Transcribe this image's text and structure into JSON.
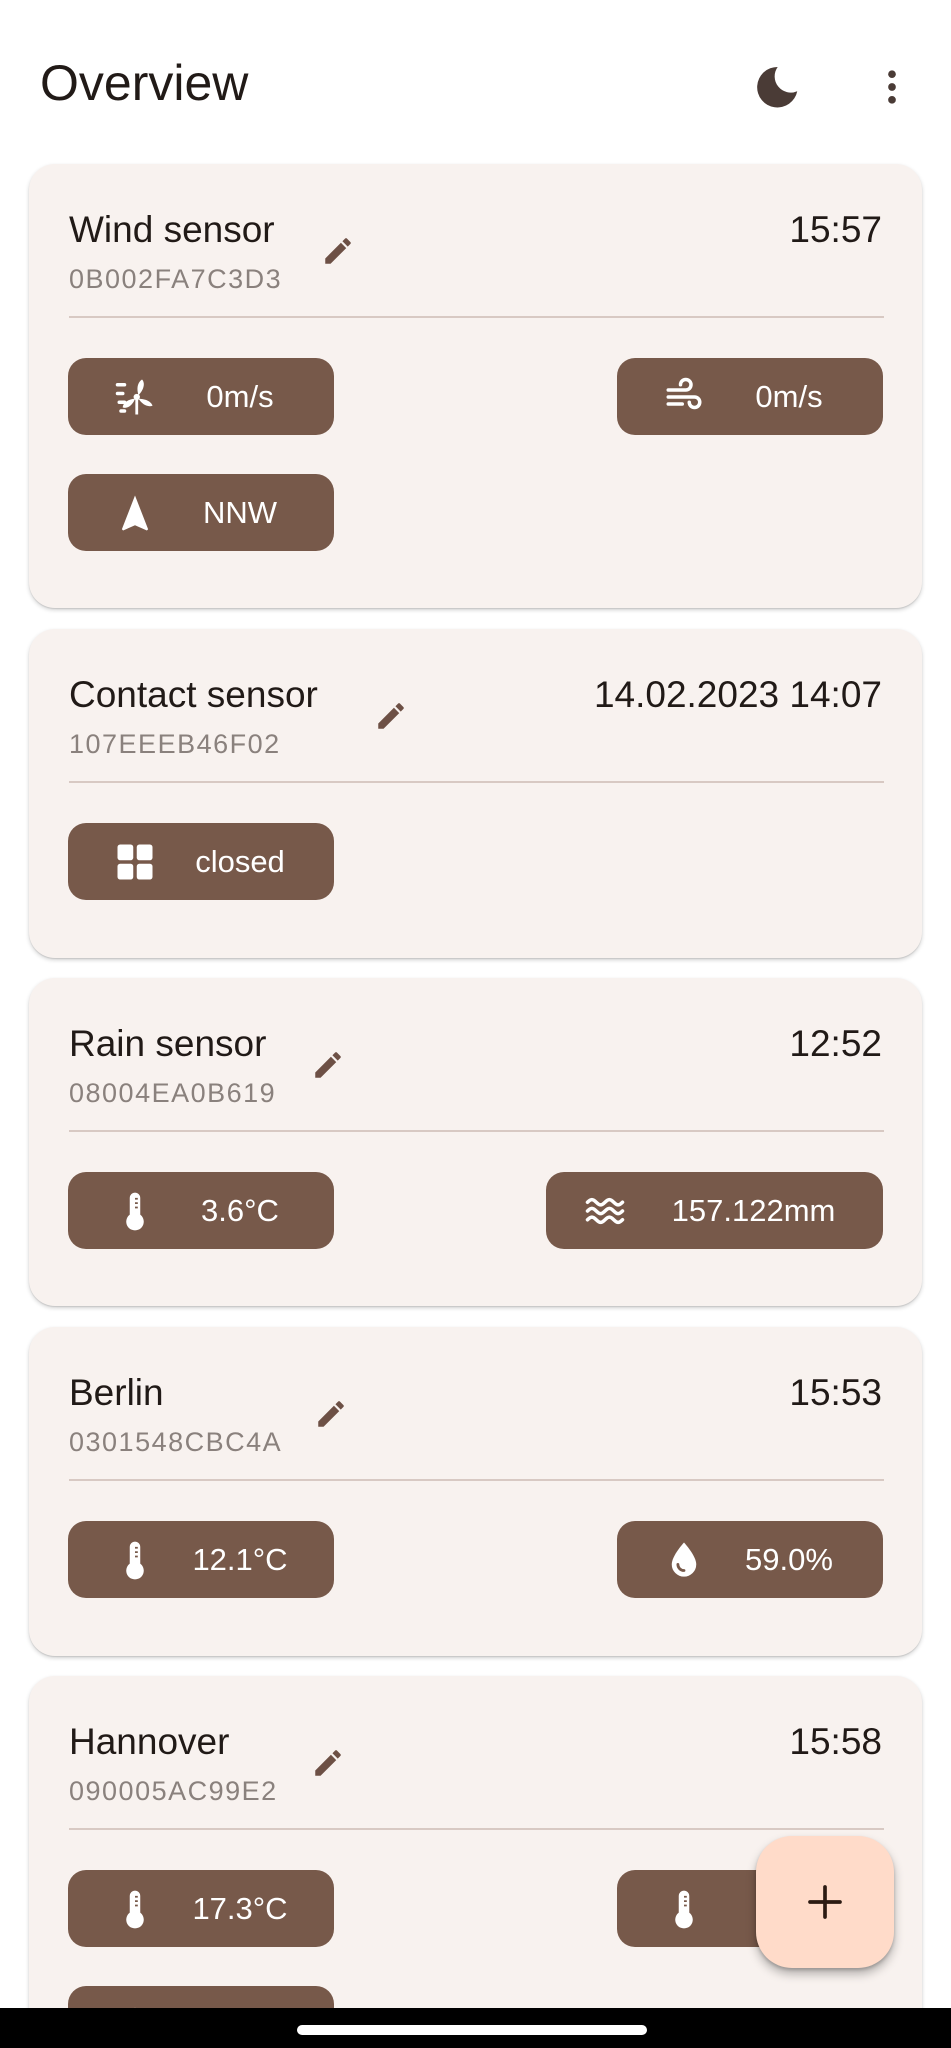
{
  "app": {
    "title": "Overview",
    "icons": {
      "theme": "moon-icon",
      "menu": "more-vert-icon",
      "add": "plus-icon"
    },
    "colors": {
      "chip": "#77594a",
      "card": "#f8f2ef",
      "fab": "#ffdbc9",
      "accent": "#6d5045"
    }
  },
  "cards": [
    {
      "name": "Wind sensor",
      "id": "0B002FA7C3D3",
      "time": "15:57",
      "chips": [
        {
          "icon": "wind-turbine-icon",
          "value": "0m/s"
        },
        {
          "icon": "wind-icon",
          "value": "0m/s"
        },
        {
          "icon": "navigation-arrow-icon",
          "value": "NNW"
        }
      ]
    },
    {
      "name": "Contact sensor",
      "id": "107EEEB46F02",
      "time": "14.02.2023 14:07",
      "chips": [
        {
          "icon": "window-icon",
          "value": "closed"
        }
      ]
    },
    {
      "name": "Rain sensor",
      "id": "08004EA0B619",
      "time": "12:52",
      "chips": [
        {
          "icon": "thermometer-icon",
          "value": "3.6°C"
        },
        {
          "icon": "waves-icon",
          "value": "157.122mm"
        }
      ]
    },
    {
      "name": "Berlin",
      "id": "0301548CBC4A",
      "time": "15:53",
      "chips": [
        {
          "icon": "thermometer-icon",
          "value": "12.1°C"
        },
        {
          "icon": "humidity-drop-icon",
          "value": "59.0%"
        }
      ]
    },
    {
      "name": "Hannover",
      "id": "090005AC99E2",
      "time": "15:58",
      "chips": [
        {
          "icon": "thermometer-icon",
          "value": "17.3°C"
        },
        {
          "icon": "thermometer-icon",
          "value": ""
        }
      ]
    }
  ]
}
